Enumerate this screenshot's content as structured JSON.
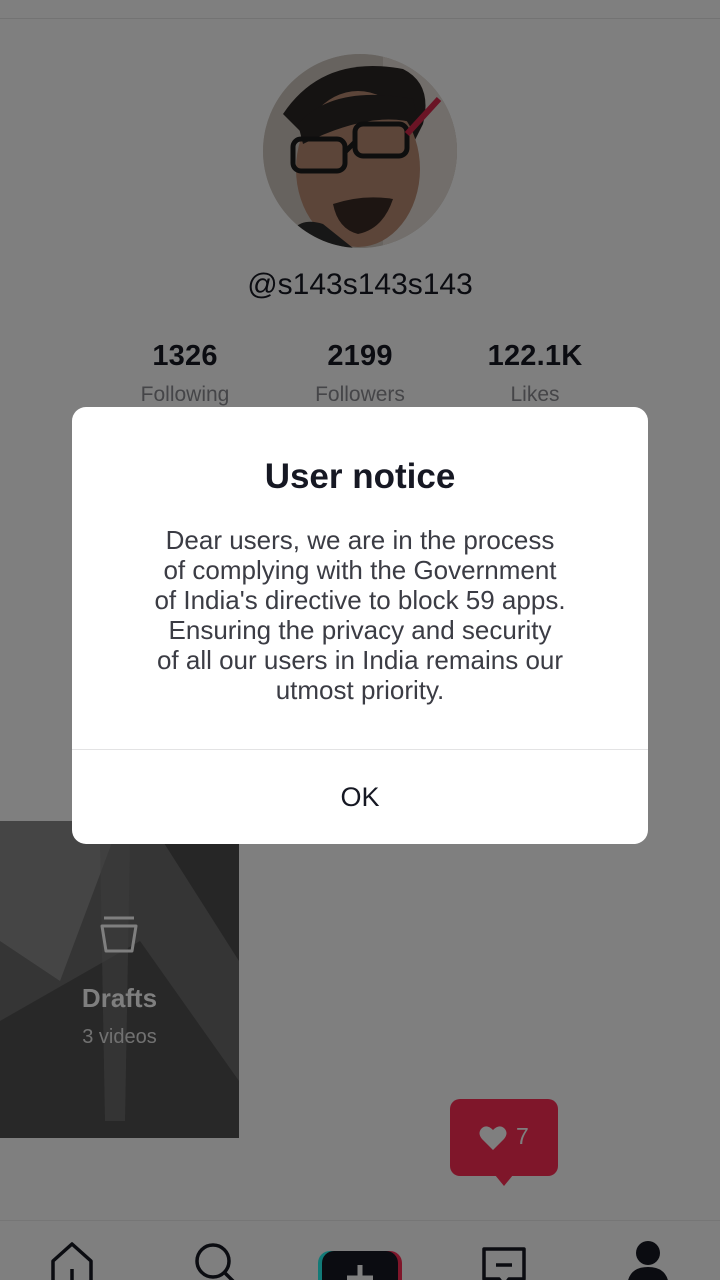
{
  "profile": {
    "username": "@s143s143s143",
    "stats": [
      {
        "value": "1326",
        "label": "Following"
      },
      {
        "value": "2199",
        "label": "Followers"
      },
      {
        "value": "122.1K",
        "label": "Likes"
      }
    ]
  },
  "drafts": {
    "title": "Drafts",
    "count": "3 videos"
  },
  "likes_bubble": {
    "count": "7",
    "color": "#fe2c55"
  },
  "bottom_nav": {
    "items": [
      {
        "icon": "home-icon"
      },
      {
        "icon": "search-icon"
      },
      {
        "icon": "plus-icon"
      },
      {
        "icon": "inbox-icon"
      },
      {
        "icon": "profile-icon"
      }
    ]
  },
  "dialog": {
    "title": "User notice",
    "body": "Dear users, we are in the process\nof complying with the Government\nof India's directive to block 59 apps.\nEnsuring the privacy and security\nof all our users in India remains our\nutmost priority.",
    "ok_label": "OK"
  }
}
